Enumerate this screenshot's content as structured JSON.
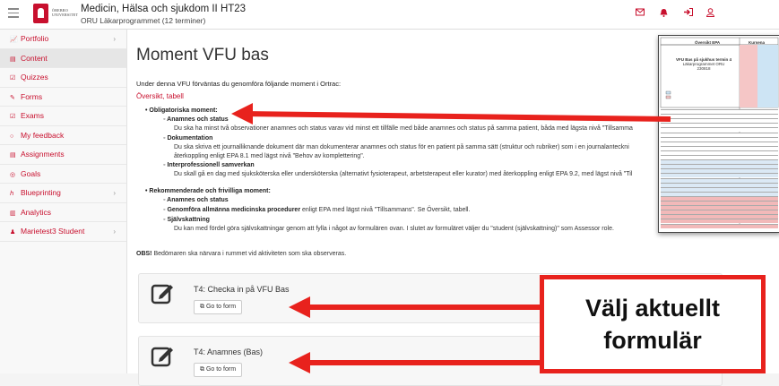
{
  "topbar": {
    "logo_text": [
      "ÖREBRO",
      "UNIVERSITET"
    ],
    "course_title": "Medicin, Hälsa och sjukdom II HT23",
    "course_subtitle": "ORU Läkarprogrammet (12 terminer)"
  },
  "sidebar": {
    "items": [
      {
        "label": "Portfolio",
        "icon": "chart-icon",
        "chevron": true
      },
      {
        "label": "Content",
        "icon": "file-icon",
        "chevron": false
      },
      {
        "label": "Quizzes",
        "icon": "checkbox-icon",
        "chevron": false
      },
      {
        "label": "Forms",
        "icon": "edit-icon",
        "chevron": false
      },
      {
        "label": "Exams",
        "icon": "checkbox-icon",
        "chevron": false
      },
      {
        "label": "My feedback",
        "icon": "comment-icon",
        "chevron": false
      },
      {
        "label": "Assignments",
        "icon": "file-icon",
        "chevron": false
      },
      {
        "label": "Goals",
        "icon": "target-icon",
        "chevron": false
      },
      {
        "label": "Blueprinting",
        "icon": "sitemap-icon",
        "chevron": true
      },
      {
        "label": "Analytics",
        "icon": "bar-chart-icon",
        "chevron": false
      },
      {
        "label": "Marietest3 Student",
        "icon": "user-icon",
        "chevron": true
      }
    ]
  },
  "main": {
    "title": "Moment VFU bas",
    "intro": "Under denna VFU förväntas du genomföra följande moment i Ortrac:",
    "overview_link": "Översikt, tabell",
    "mandatory_heading": "Obligatoriska moment:",
    "m1_title": "Anamnes och status",
    "m1_text": "Du ska ha minst två observationer anamnes och status varav vid minst ett tillfälle med både anamnes och status på samma patient, båda med lägsta nivå \"Tillsamma",
    "m2_title": "Dokumentation",
    "m2_text1": "Du ska skriva ett journalliknande dokument där man dokumenterar anamnes och status för en patient på samma sätt (struktur och rubriker) som i en journalanteckni",
    "m2_text2": "återkoppling enligt EPA 8.1 med lägst nivå \"Behov av komplettering\".",
    "m3_title": "Interprofessionell samverkan",
    "m3_text": "Du skall gå en dag med sjuksköterska eller undersköterska (alternativt fysioterapeut, arbetsterapeut eller kurator) med återkoppling enligt EPA 9.2, med lägst nivå \"Til",
    "rec_heading": "Rekommenderade och frivilliga moment:",
    "r1_title": "Anamnes och status",
    "r2_title": "Genomföra allmänna medicinska procedurer",
    "r2_text": " enligt EPA med lägst nivå \"Tillsammans\". Se Översikt, tabell.",
    "r3_title": "Självskattning",
    "r3_text": "Du kan med fördel göra självskattningar genom att fylla i något av formulären ovan. I slutet av formuläret väljer du \"student (självskattning)\" som Assessor role.",
    "obs_label": "OBS!",
    "obs_text": " Bedömaren ska närvara i rummet vid aktiviteten som ska observeras.",
    "cards": [
      {
        "title": "T4: Checka in på VFU Bas",
        "button": "Go to form"
      },
      {
        "title": "T4: Anamnes (Bas)",
        "button": "Go to form"
      }
    ]
  },
  "overlay": {
    "title": "Översikt EPA",
    "title2": "Kursena",
    "subtitle": "VFU Bas på sjukhus termin 4",
    "subtitle2": "Läkarprogrammet ORU",
    "subtitle3": "230818"
  },
  "callout": {
    "line1": "Välj aktuellt",
    "line2": "formulär"
  },
  "colors": {
    "accent": "#c8102e",
    "arrow": "#e8221d"
  }
}
